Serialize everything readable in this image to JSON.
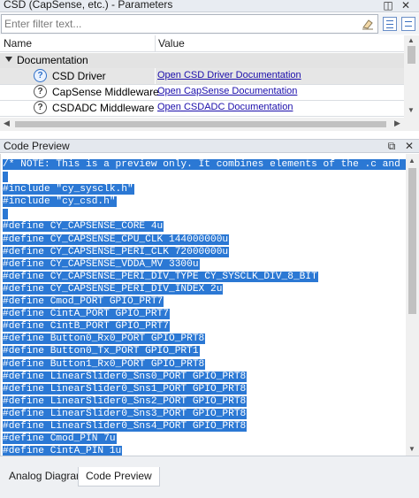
{
  "params_pane": {
    "title": "CSD (CapSense, etc.) - Parameters",
    "pin_icon": "pin-icon",
    "close_icon": "close-icon",
    "filter_placeholder": "Enter filter text...",
    "columns": {
      "name": "Name",
      "value": "Value"
    },
    "group": {
      "label": "Documentation",
      "expanded": true
    },
    "rows": [
      {
        "name": "CSD Driver",
        "value": "Open CSD Driver Documentation",
        "selected": true
      },
      {
        "name": "CapSense Middleware",
        "value": "Open CapSense Documentation",
        "selected": false
      },
      {
        "name": "CSDADC Middleware",
        "value": "Open CSDADC Documentation",
        "selected": false
      }
    ]
  },
  "code_pane": {
    "title": "Code Preview",
    "lines": [
      "/* NOTE: This is a preview only. It combines elements of the .c and .h",
      "",
      "#include \"cy_sysclk.h\"",
      "#include \"cy_csd.h\"",
      "",
      "#define CY_CAPSENSE_CORE 4u",
      "#define CY_CAPSENSE_CPU_CLK 144000000u",
      "#define CY_CAPSENSE_PERI_CLK 72000000u",
      "#define CY_CAPSENSE_VDDA_MV 3300u",
      "#define CY_CAPSENSE_PERI_DIV_TYPE CY_SYSCLK_DIV_8_BIT",
      "#define CY_CAPSENSE_PERI_DIV_INDEX 2u",
      "#define Cmod_PORT GPIO_PRT7",
      "#define CintA_PORT GPIO_PRT7",
      "#define CintB_PORT GPIO_PRT7",
      "#define Button0_Rx0_PORT GPIO_PRT8",
      "#define Button0_Tx_PORT GPIO_PRT1",
      "#define Button1_Rx0_PORT GPIO_PRT8",
      "#define LinearSlider0_Sns0_PORT GPIO_PRT8",
      "#define LinearSlider0_Sns1_PORT GPIO_PRT8",
      "#define LinearSlider0_Sns2_PORT GPIO_PRT8",
      "#define LinearSlider0_Sns3_PORT GPIO_PRT8",
      "#define LinearSlider0_Sns4_PORT GPIO_PRT8",
      "#define Cmod_PIN 7u",
      "#define CintA_PIN 1u"
    ],
    "selection_color": "#2b78d4"
  },
  "bottom_tabs": [
    {
      "label": "Analog Diagram",
      "active": false
    },
    {
      "label": "Code Preview",
      "active": true
    }
  ]
}
